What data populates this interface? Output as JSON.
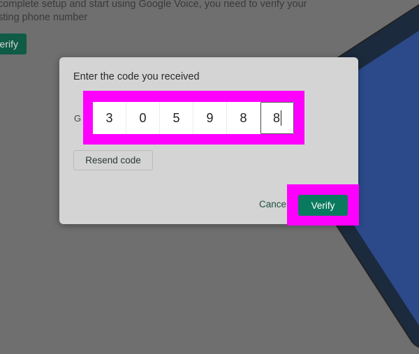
{
  "background_page": {
    "intro_line_1": "complete setup and start using Google Voice, you need to verify your",
    "intro_line_2": "sting phone number",
    "verify_label": "erify"
  },
  "dialog": {
    "title": "Enter the code you received",
    "code_prefix": "G",
    "code_digits": [
      "3",
      "0",
      "5",
      "9",
      "8",
      "8"
    ],
    "resend_label": "Resend code",
    "cancel_label": "Cancel",
    "verify_label": "Verify"
  },
  "colors": {
    "highlight": "#ff00ff",
    "primary_button": "#0a7a5e",
    "dialog_bg": "#d4d4d4",
    "overlay_bg": "#6f6f6f"
  }
}
